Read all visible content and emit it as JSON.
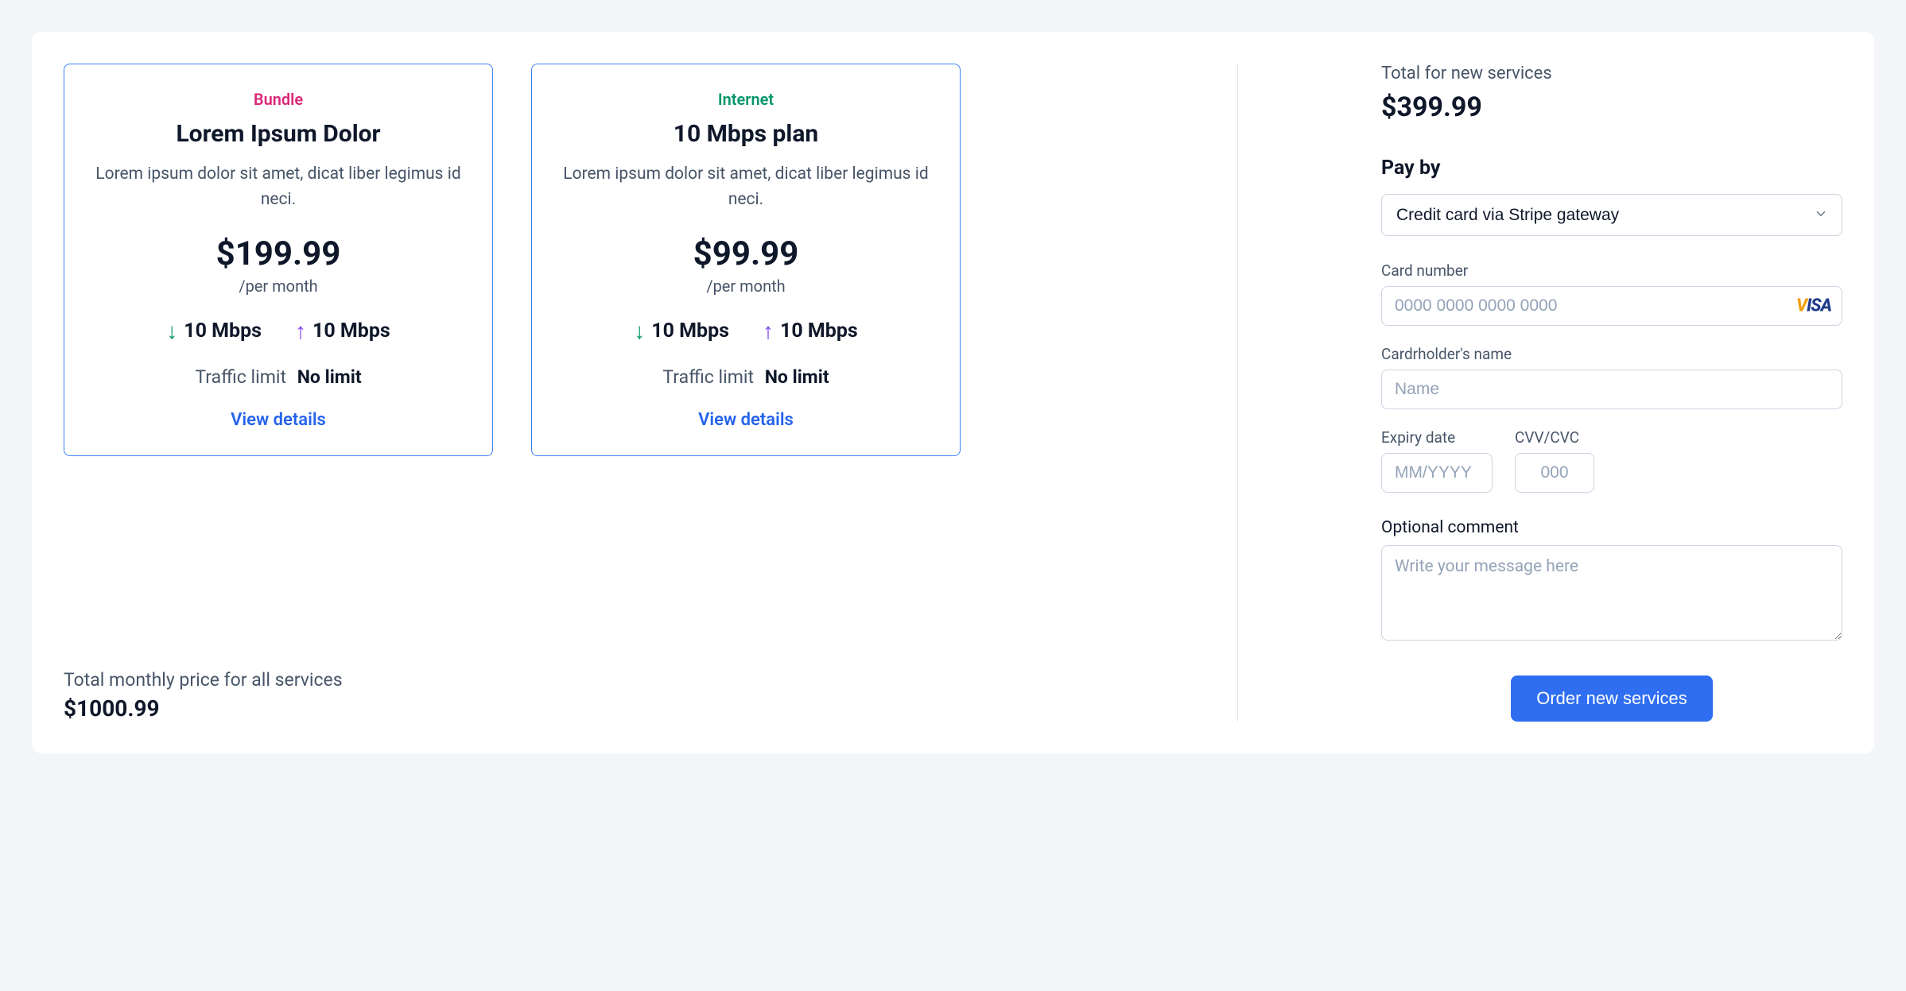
{
  "plans": [
    {
      "tag": "Bundle",
      "tag_class": "bundle",
      "title": "Lorem Ipsum Dolor",
      "desc": "Lorem ipsum dolor sit amet, dicat liber legimus id neci.",
      "price": "$199.99",
      "period": "/per month",
      "down": "10 Mbps",
      "up": "10 Mbps",
      "traffic_label": "Traffic limit",
      "traffic_value": "No limit",
      "view": "View details"
    },
    {
      "tag": "Internet",
      "tag_class": "internet",
      "title": "10 Mbps plan",
      "desc": "Lorem ipsum dolor sit amet, dicat liber legimus id neci.",
      "price": "$99.99",
      "period": "/per month",
      "down": "10 Mbps",
      "up": "10 Mbps",
      "traffic_label": "Traffic limit",
      "traffic_value": "No limit",
      "view": "View details"
    }
  ],
  "footer": {
    "label": "Total monthly price for all services",
    "value": "$1000.99"
  },
  "checkout": {
    "total_label": "Total for new services",
    "total_value": "$399.99",
    "pay_by_title": "Pay by",
    "pay_method_selected": "Credit card via Stripe gateway",
    "card_number_label": "Card number",
    "card_number_placeholder": "0000 0000 0000 0000",
    "card_brand_v": "V",
    "card_brand_rest": "ISA",
    "cardholder_label": "Cardrholder's name",
    "cardholder_placeholder": "Name",
    "expiry_label": "Expiry date",
    "expiry_placeholder": "MM/YYYY",
    "cvv_label": "CVV/CVC",
    "cvv_placeholder": "000",
    "comment_label": "Optional comment",
    "comment_placeholder": "Write your message here",
    "order_button": "Order new services"
  }
}
